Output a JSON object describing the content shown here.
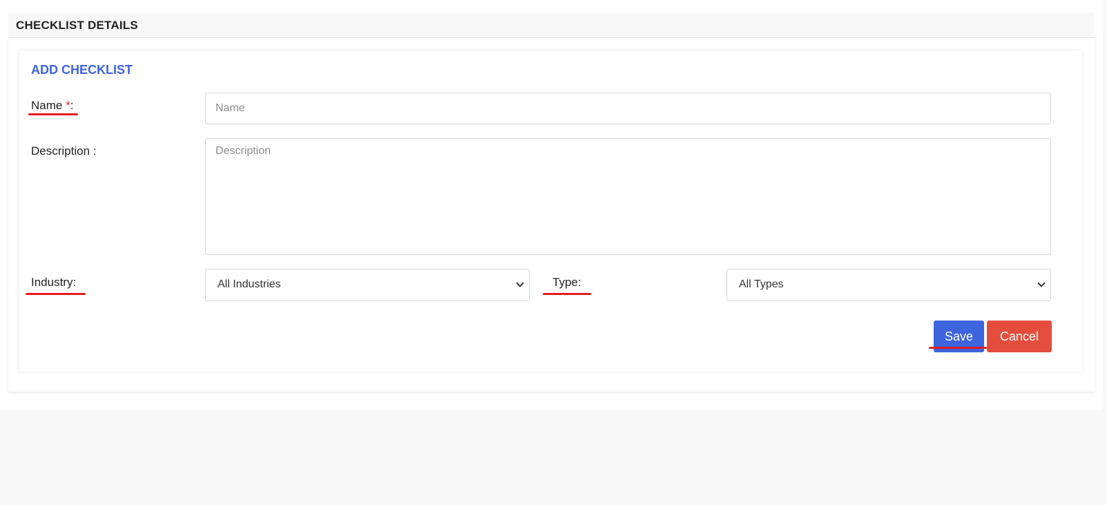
{
  "section": {
    "title": "CHECKLIST DETAILS"
  },
  "form": {
    "title": "ADD CHECKLIST",
    "name": {
      "label": "Name ",
      "required_marker": "*",
      "colon": ":",
      "placeholder": "Name",
      "value": ""
    },
    "description": {
      "label": "Description :",
      "placeholder": "Description",
      "value": ""
    },
    "industry": {
      "label": "Industry:",
      "selected": "All Industries"
    },
    "type": {
      "label": "Type:",
      "selected": "All Types"
    }
  },
  "actions": {
    "save_label": "Save",
    "cancel_label": "Cancel"
  },
  "colors": {
    "accent": "#3d63dd",
    "danger": "#e44d3c",
    "annotation_underline": "#e31b1b",
    "required": "#e02424"
  }
}
